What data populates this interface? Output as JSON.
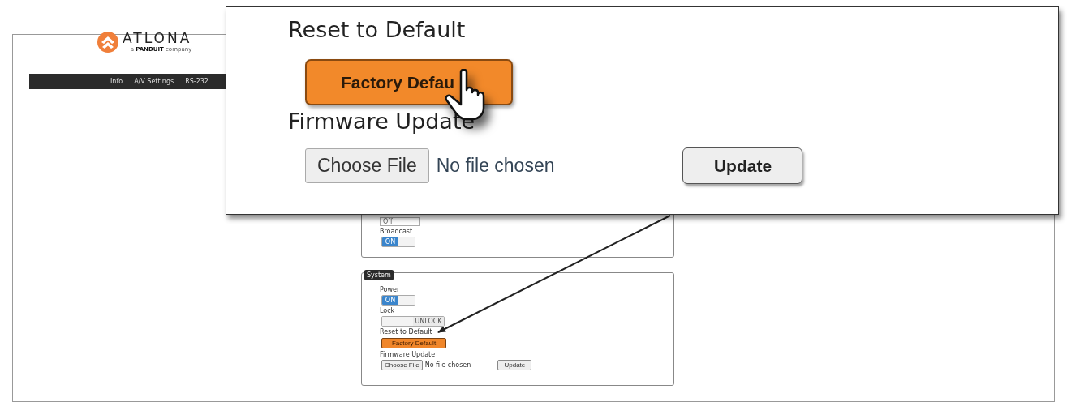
{
  "logo": {
    "name": "ATLONA",
    "tagline": "a **PANDUIT** company"
  },
  "nav": [
    {
      "label": "Info"
    },
    {
      "label": "A/V Settings"
    },
    {
      "label": "RS-232"
    }
  ],
  "broadcast_panel": {
    "select_value": "Off",
    "label": "Broadcast",
    "toggle": {
      "text": "ON",
      "on": true
    }
  },
  "system_panel": {
    "title": "System",
    "rows": [
      {
        "kind": "toggle",
        "label": "Power",
        "toggle_text": "ON",
        "on": true
      },
      {
        "kind": "toggle",
        "label": "Lock",
        "toggle_text": "UNLOCK",
        "on": false
      },
      {
        "kind": "button",
        "label": "Reset to Default",
        "button": "Factory Default"
      },
      {
        "kind": "file",
        "label": "Firmware Update",
        "choose": "Choose File",
        "status": "No file chosen",
        "submit": "Update"
      }
    ]
  },
  "callout": {
    "reset_heading": "Reset to Default",
    "factory_button": "Factory Defau",
    "firmware_heading": "Firmware Update",
    "choose": "Choose File",
    "status": "No file chosen",
    "submit": "Update"
  }
}
